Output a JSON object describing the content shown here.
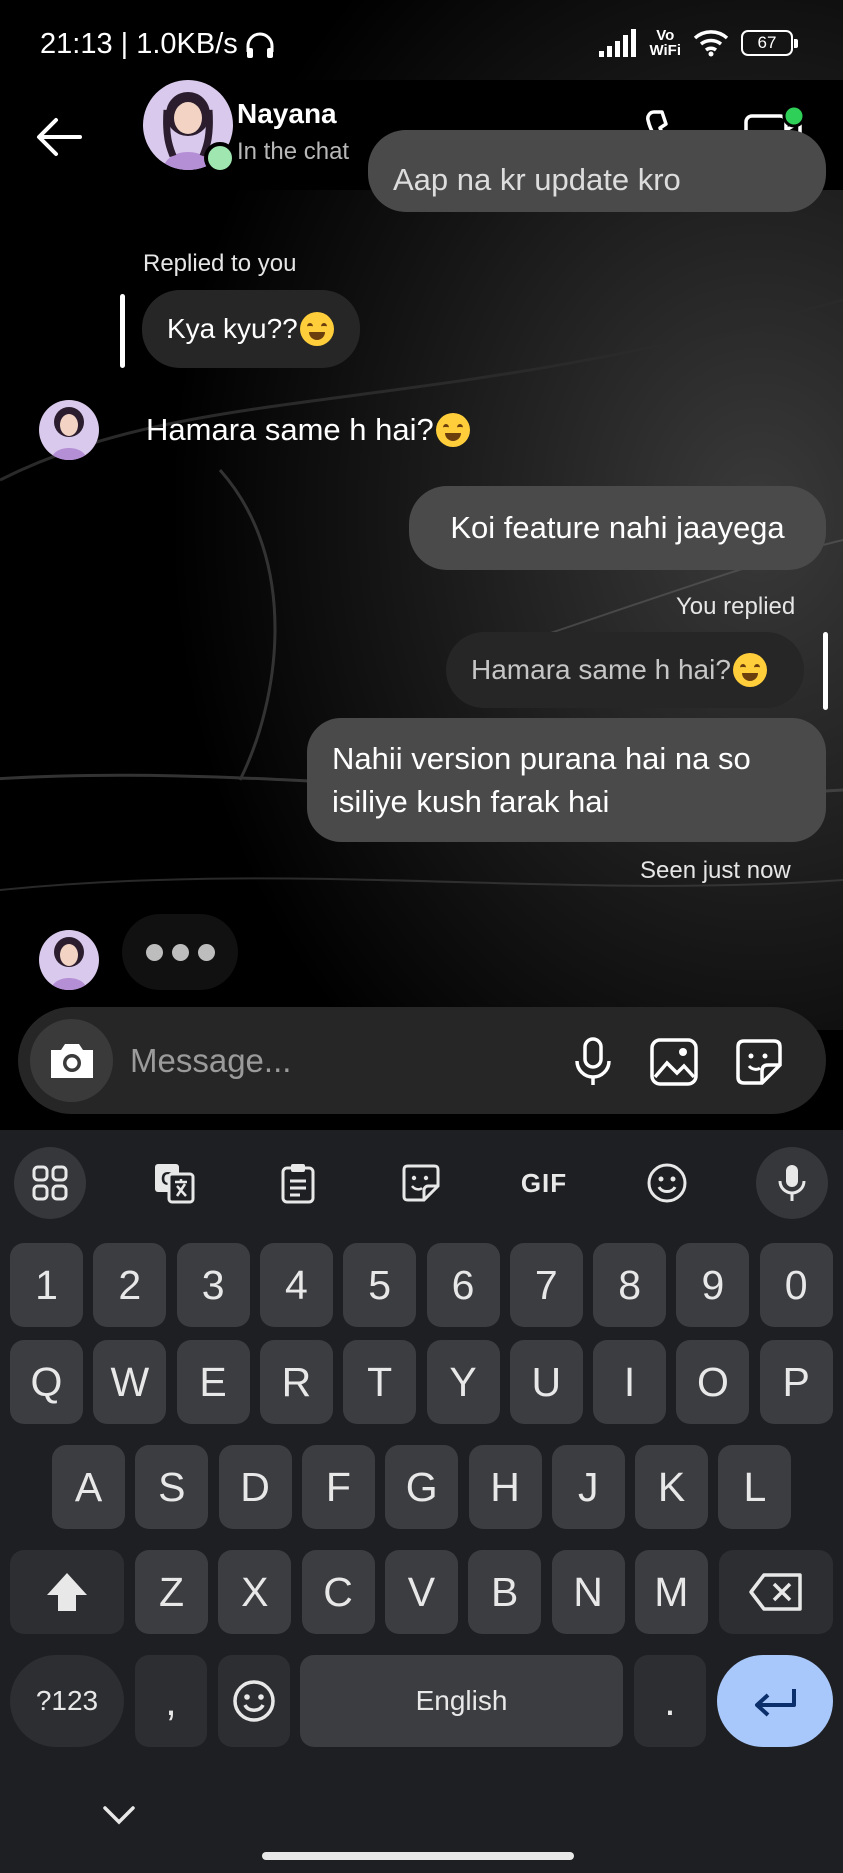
{
  "status_bar": {
    "time_speed": "21:13 | 1.0KB/s",
    "network_label_top": "Vo",
    "network_label_bottom": "WiFi",
    "battery": "67"
  },
  "header": {
    "contact_name": "Nayana",
    "contact_status": "In the chat"
  },
  "messages": {
    "clipped_top": "Aap na kr update kro",
    "reply_label": "Replied to you",
    "quoted_in": "Kya kyu??",
    "in_1": "Hamara same h hai?",
    "out_1": "Koi feature nahi jaayega",
    "you_replied_label": "You replied",
    "quoted_out": "Hamara same h hai?",
    "out_2_line1": "Nahii version purana hai na so",
    "out_2_line2": "isiliye kush farak hai",
    "seen": "Seen just now"
  },
  "composer": {
    "placeholder": "Message..."
  },
  "keyboard": {
    "toolbar_gif": "GIF",
    "number_row": [
      "1",
      "2",
      "3",
      "4",
      "5",
      "6",
      "7",
      "8",
      "9",
      "0"
    ],
    "row1": [
      "Q",
      "W",
      "E",
      "R",
      "T",
      "Y",
      "U",
      "I",
      "O",
      "P"
    ],
    "row2": [
      "A",
      "S",
      "D",
      "F",
      "G",
      "H",
      "J",
      "K",
      "L"
    ],
    "row3": [
      "Z",
      "X",
      "C",
      "V",
      "B",
      "N",
      "M"
    ],
    "symbols_key": "?123",
    "comma_key": ",",
    "space_key": "English",
    "period_key": "."
  }
}
